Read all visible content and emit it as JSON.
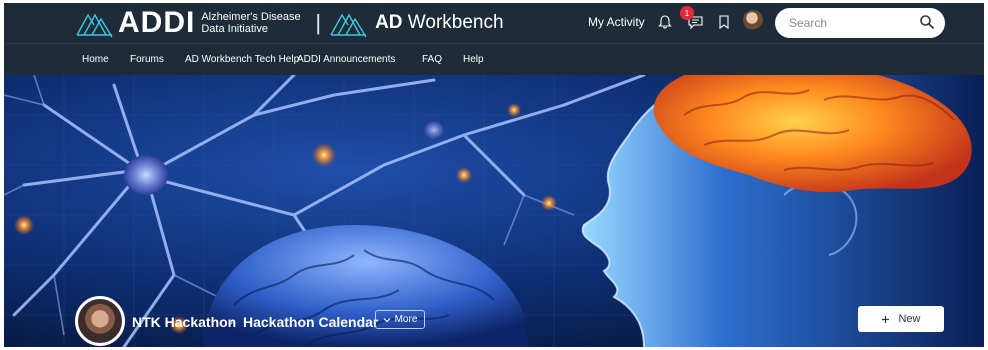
{
  "header": {
    "brand_addi": "ADDI",
    "brand_subtitle": "Alzheimer's Disease Data Initiative",
    "separator": "|",
    "brand_ad_bold": "AD",
    "brand_ad_rest": " Workbench",
    "my_activity": "My Activity",
    "notification_count": "1",
    "search": {
      "placeholder": "Search"
    }
  },
  "nav": {
    "items": [
      {
        "label": "Home"
      },
      {
        "label": "Forums"
      },
      {
        "label": "AD Workbench Tech Help"
      },
      {
        "label": "ADDI Announcements"
      },
      {
        "label": "FAQ"
      },
      {
        "label": "Help"
      }
    ]
  },
  "hero": {
    "breadcrumb": [
      {
        "label": "NTK Hackathon"
      },
      {
        "label": "Hackathon Calendar"
      }
    ],
    "breadcrumb_separator": "›",
    "more_label": "More",
    "new_label": "New"
  },
  "colors": {
    "header_bg": "#1d2c38",
    "badge": "#e5293b",
    "logo_teal": "#3fc6e3"
  }
}
